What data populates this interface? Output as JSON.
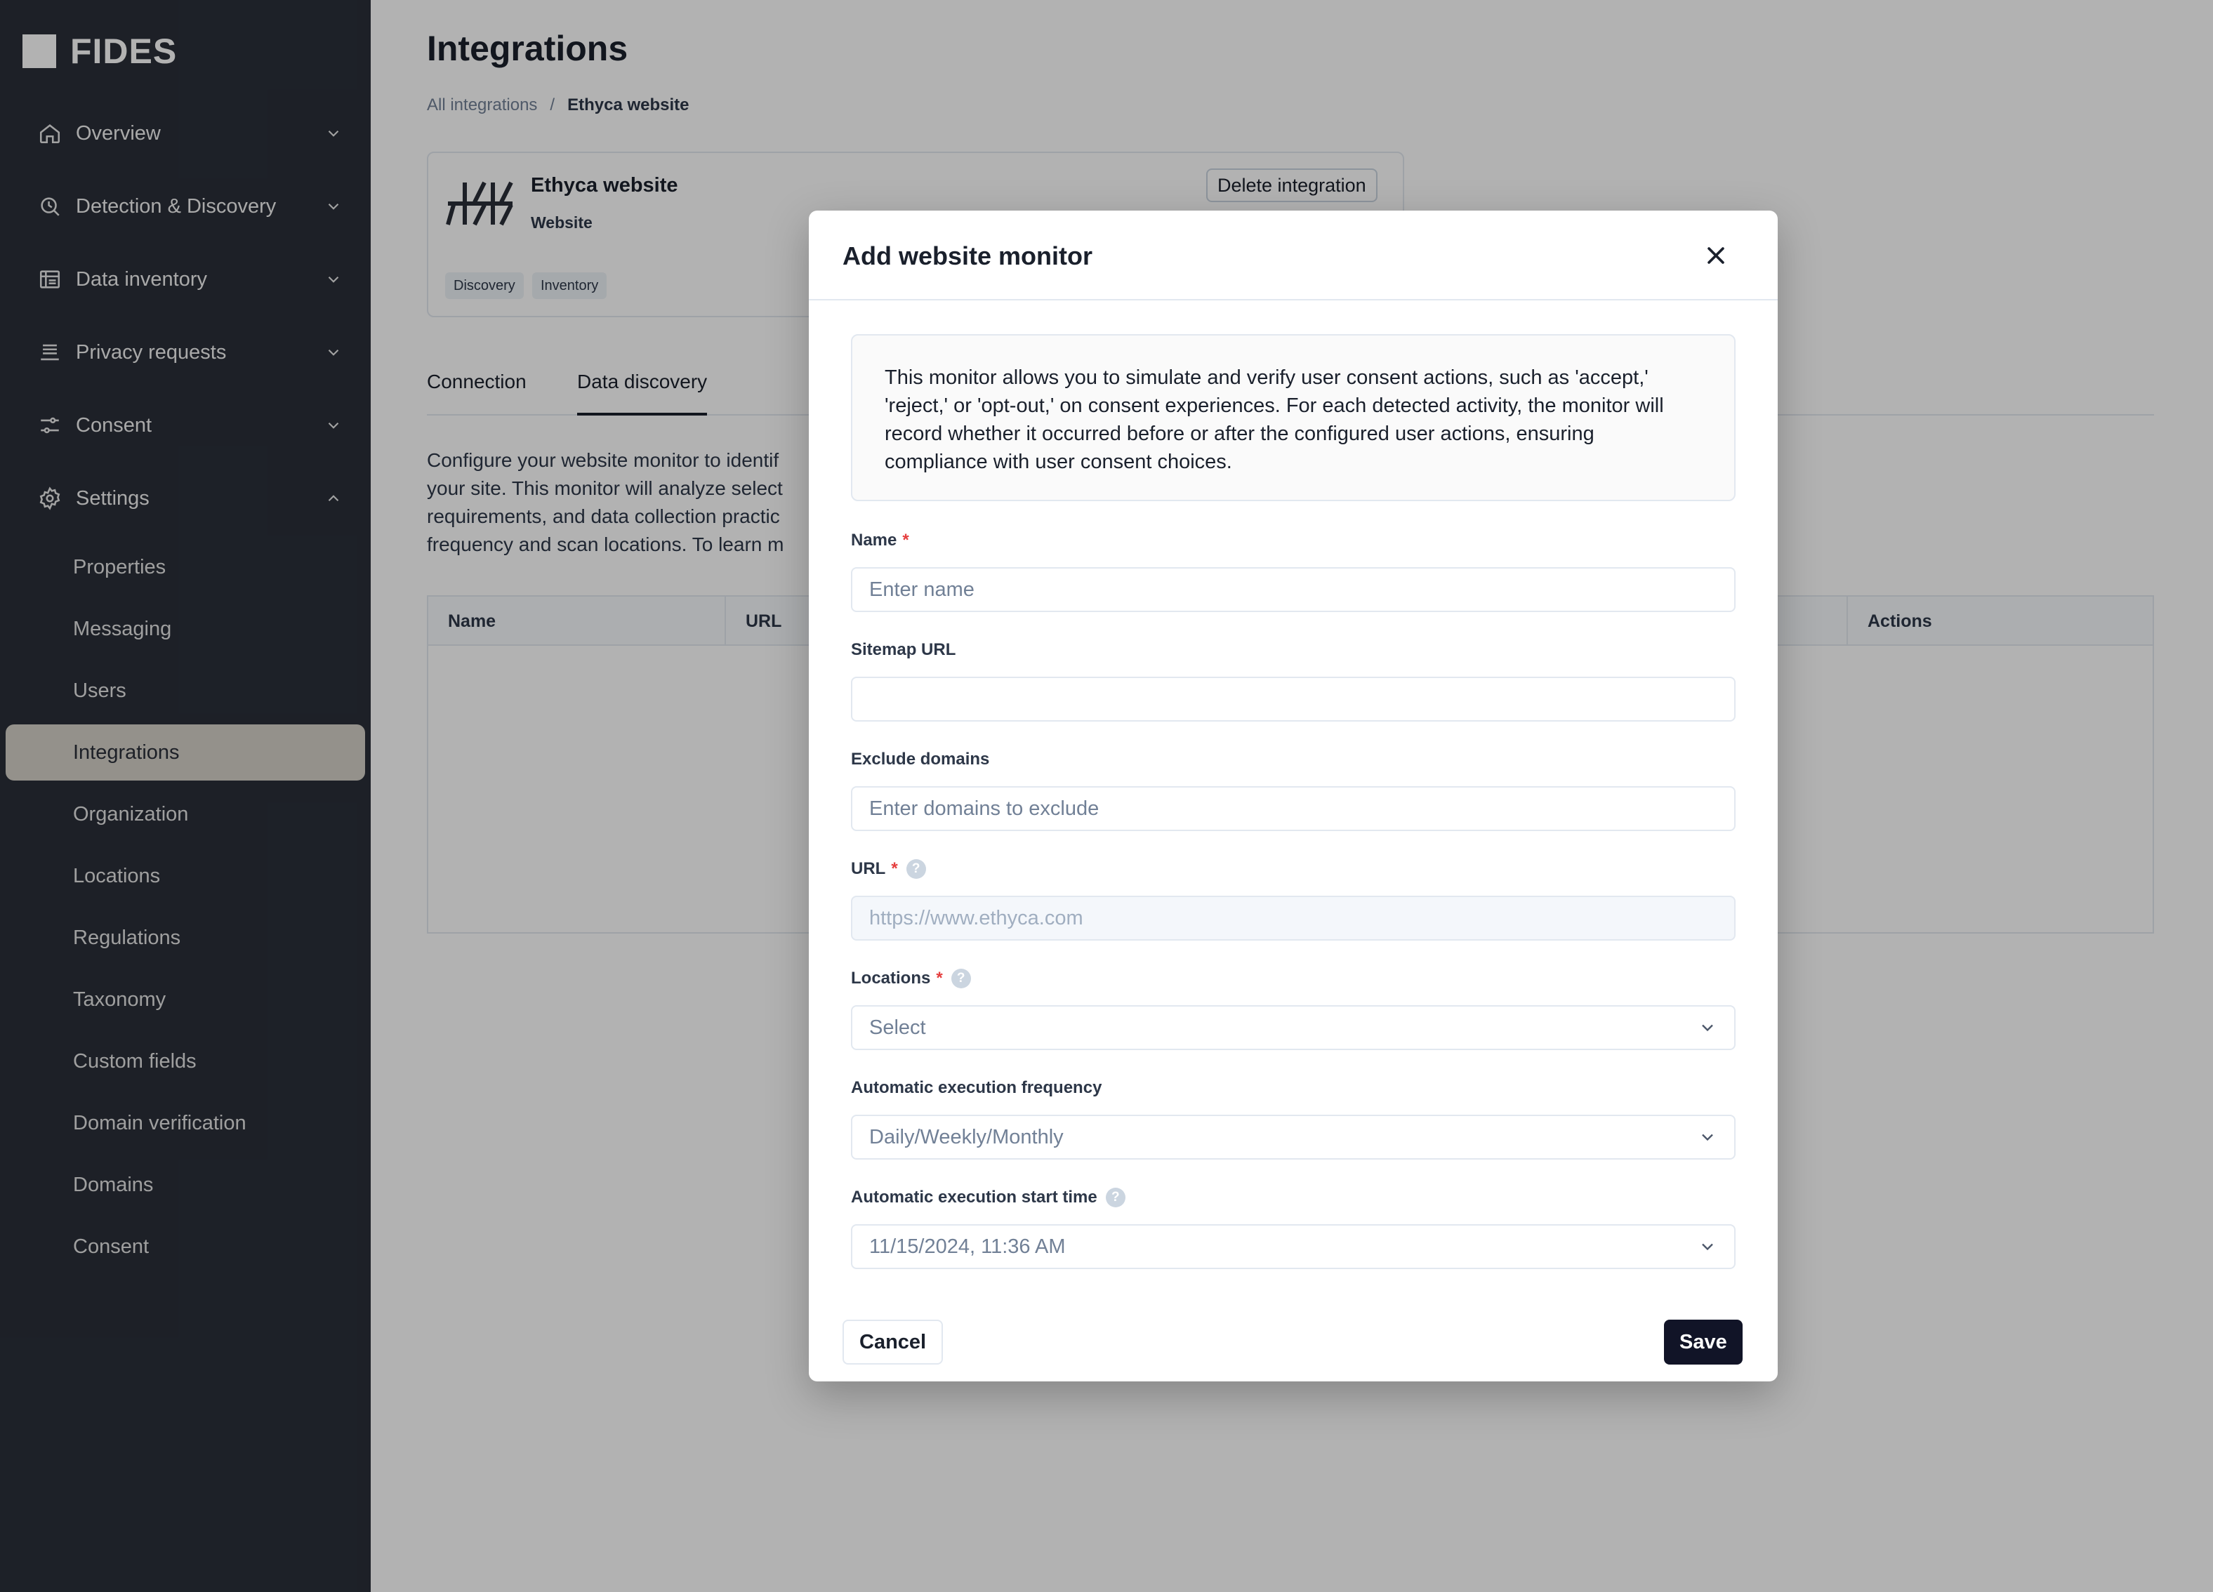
{
  "brand": {
    "name": "FIDES"
  },
  "sidebar": {
    "nav": [
      {
        "label": "Overview",
        "icon": "home-icon",
        "expanded": false
      },
      {
        "label": "Detection & Discovery",
        "icon": "radar-search-icon",
        "expanded": false
      },
      {
        "label": "Data inventory",
        "icon": "database-grid-icon",
        "expanded": false
      },
      {
        "label": "Privacy requests",
        "icon": "request-list-icon",
        "expanded": false
      },
      {
        "label": "Consent",
        "icon": "sliders-icon",
        "expanded": false
      },
      {
        "label": "Settings",
        "icon": "gear-icon",
        "expanded": true
      }
    ],
    "settings_items": [
      {
        "label": "Properties"
      },
      {
        "label": "Messaging"
      },
      {
        "label": "Users"
      },
      {
        "label": "Integrations",
        "active": true
      },
      {
        "label": "Organization"
      },
      {
        "label": "Locations"
      },
      {
        "label": "Regulations"
      },
      {
        "label": "Taxonomy"
      },
      {
        "label": "Custom fields"
      },
      {
        "label": "Domain verification"
      },
      {
        "label": "Domains"
      },
      {
        "label": "Consent"
      }
    ]
  },
  "page": {
    "title": "Integrations",
    "breadcrumb": {
      "root": "All integrations",
      "separator": "/",
      "current": "Ethyca website"
    },
    "integration": {
      "name": "Ethyca website",
      "type": "Website",
      "delete_label": "Delete integration",
      "tags": [
        "Discovery",
        "Inventory"
      ]
    },
    "tabs": [
      {
        "label": "Connection",
        "active": false
      },
      {
        "label": "Data discovery",
        "active": true
      }
    ],
    "description_lines": [
      "Configure your website monitor to identif",
      "your site. This monitor will analyze select",
      "requirements, and data collection practic",
      "frequency and scan locations. To learn m"
    ],
    "table": {
      "columns": [
        "Name",
        "URL",
        "Actions"
      ]
    }
  },
  "modal": {
    "title": "Add website monitor",
    "info": "This monitor allows you to simulate and verify user consent actions, such as 'accept,' 'reject,' or 'opt-out,' on consent experiences. For each detected activity, the monitor will record whether it occurred before or after the configured user actions, ensuring compliance with user consent choices.",
    "fields": {
      "name": {
        "label": "Name",
        "required_mark": "*",
        "placeholder": "Enter name"
      },
      "sitemap": {
        "label": "Sitemap URL",
        "placeholder": ""
      },
      "exclude": {
        "label": "Exclude domains",
        "placeholder": "Enter domains to exclude"
      },
      "url": {
        "label": "URL",
        "required_mark": "*",
        "help": "?",
        "placeholder": "https://www.ethyca.com"
      },
      "locations": {
        "label": "Locations",
        "required_mark": "*",
        "help": "?",
        "value": "Select"
      },
      "frequency": {
        "label": "Automatic execution frequency",
        "value": "Daily/Weekly/Monthly"
      },
      "start_time": {
        "label": "Automatic execution start time",
        "help": "?",
        "value": "11/15/2024, 11:36 AM"
      }
    },
    "cancel_label": "Cancel",
    "save_label": "Save"
  },
  "colors": {
    "sidebar_bg": "#2a2f39",
    "active_item_bg": "#d4d0c8",
    "primary_button": "#111427",
    "required": "#e53e3e"
  }
}
